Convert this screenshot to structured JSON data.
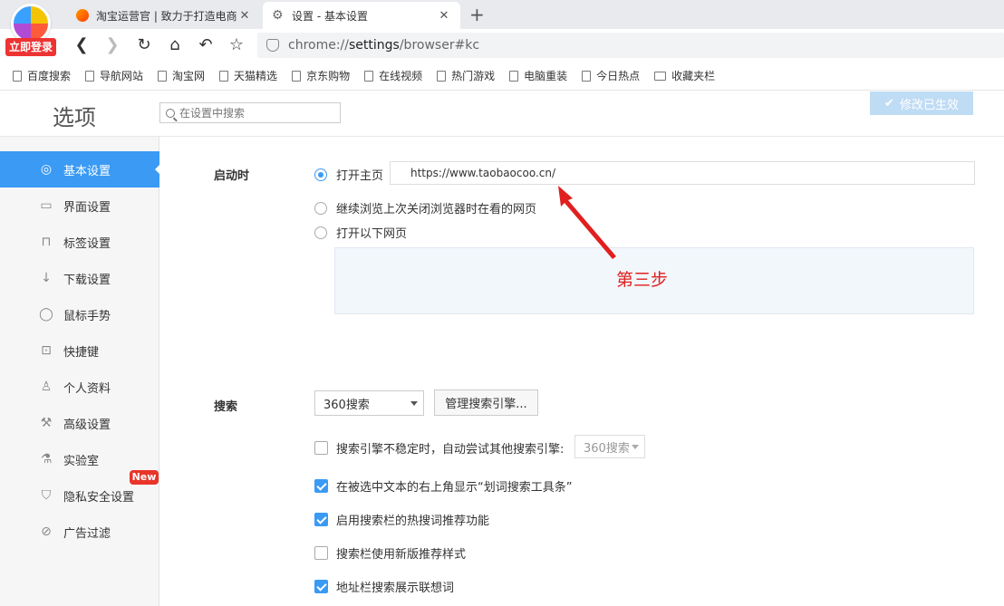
{
  "browser": {
    "login_badge": "立即登录",
    "tabs": [
      {
        "title": "淘宝运营官 | 致力于打造电商",
        "active": false
      },
      {
        "title": "设置 - 基本设置",
        "active": true
      }
    ],
    "new_tab": "+",
    "url_prefix": "chrome://",
    "url_host": "settings",
    "url_path": "/browser#kc",
    "bookmarks": [
      "百度搜索",
      "导航网站",
      "淘宝网",
      "天猫精选",
      "京东购物",
      "在线视频",
      "热门游戏",
      "电脑重装",
      "今日热点",
      "收藏夹栏"
    ]
  },
  "header": {
    "title": "选项",
    "search_placeholder": "在设置中搜索",
    "saved_label": "修改已生效"
  },
  "sidebar": {
    "items": [
      {
        "label": "基本设置",
        "icon": "gear-icon",
        "active": true
      },
      {
        "label": "界面设置",
        "icon": "window-icon"
      },
      {
        "label": "标签设置",
        "icon": "tab-icon"
      },
      {
        "label": "下载设置",
        "icon": "download-icon"
      },
      {
        "label": "鼠标手势",
        "icon": "mouse-icon"
      },
      {
        "label": "快捷键",
        "icon": "keyboard-icon"
      },
      {
        "label": "个人资料",
        "icon": "user-icon"
      },
      {
        "label": "高级设置",
        "icon": "wrench-icon"
      },
      {
        "label": "实验室",
        "icon": "flask-icon"
      },
      {
        "label": "隐私安全设置",
        "icon": "shield-icon"
      },
      {
        "label": "广告过滤",
        "icon": "block-icon"
      }
    ],
    "new_badge": "New"
  },
  "startup": {
    "label": "启动时",
    "options": [
      "打开主页",
      "继续浏览上次关闭浏览器时在看的网页",
      "打开以下网页"
    ],
    "selected": 0,
    "homepage_url": "https://www.taobaocoo.cn/",
    "annotation": "第三步"
  },
  "search": {
    "label": "搜索",
    "engine": "360搜索",
    "manage_button": "管理搜索引擎...",
    "options": [
      {
        "label": "搜索引擎不稳定时，自动尝试其他搜索引擎:",
        "checked": false,
        "fallback": "360搜索"
      },
      {
        "label": "在被选中文本的右上角显示“划词搜索工具条”",
        "checked": true
      },
      {
        "label": "启用搜索栏的热搜词推荐功能",
        "checked": true
      },
      {
        "label": "搜索栏使用新版推荐样式",
        "checked": false
      },
      {
        "label": "地址栏搜索展示联想词",
        "checked": true
      }
    ]
  },
  "colors": {
    "accent": "#3a9af4",
    "annotation": "#e02020",
    "new_badge": "#e8352a"
  }
}
